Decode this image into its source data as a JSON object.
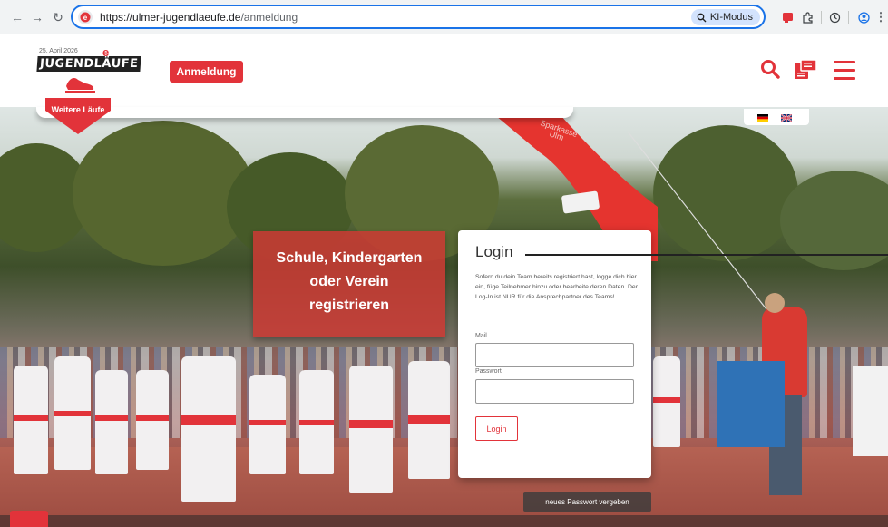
{
  "browser": {
    "url_host": "https://ulmer-jugendlaeufe.de",
    "url_path": "/anmeldung",
    "ai_mode_label": "KI-Modus",
    "icons": [
      "back-icon",
      "forward-icon",
      "reload-icon",
      "site-info-icon",
      "extension-icon",
      "puzzle-icon",
      "history-icon",
      "profile-icon",
      "menu-icon"
    ]
  },
  "logo": {
    "date": "25. April 2026",
    "wordmark": "JUGENDLÄUFE"
  },
  "header": {
    "register_button": "Anmeldung",
    "more_runs_badge": "Weitere Läufe",
    "icons": [
      "search-icon",
      "registration-icon",
      "hamburger-menu-icon"
    ],
    "accent_color": "#e2333a"
  },
  "languages": [
    "de",
    "en"
  ],
  "hero": {
    "school_box": [
      "Schule, Kindergarten",
      "oder Verein",
      "registrieren"
    ],
    "arch_text": [
      "Sparkasse",
      "Ulm"
    ]
  },
  "login": {
    "title": "Login",
    "description": "Sofern du dein Team bereits registriert hast, logge dich hier ein, füge Teilnehmer hinzu oder bearbeite deren Daten. Der Log-In ist NUR für die Ansprechpartner des Teams!",
    "mail_label": "Mail",
    "mail_value": "",
    "password_label": "Passwort",
    "password_value": "",
    "submit_label": "Login",
    "forgot_password_button": "neues Passwort vergeben"
  }
}
